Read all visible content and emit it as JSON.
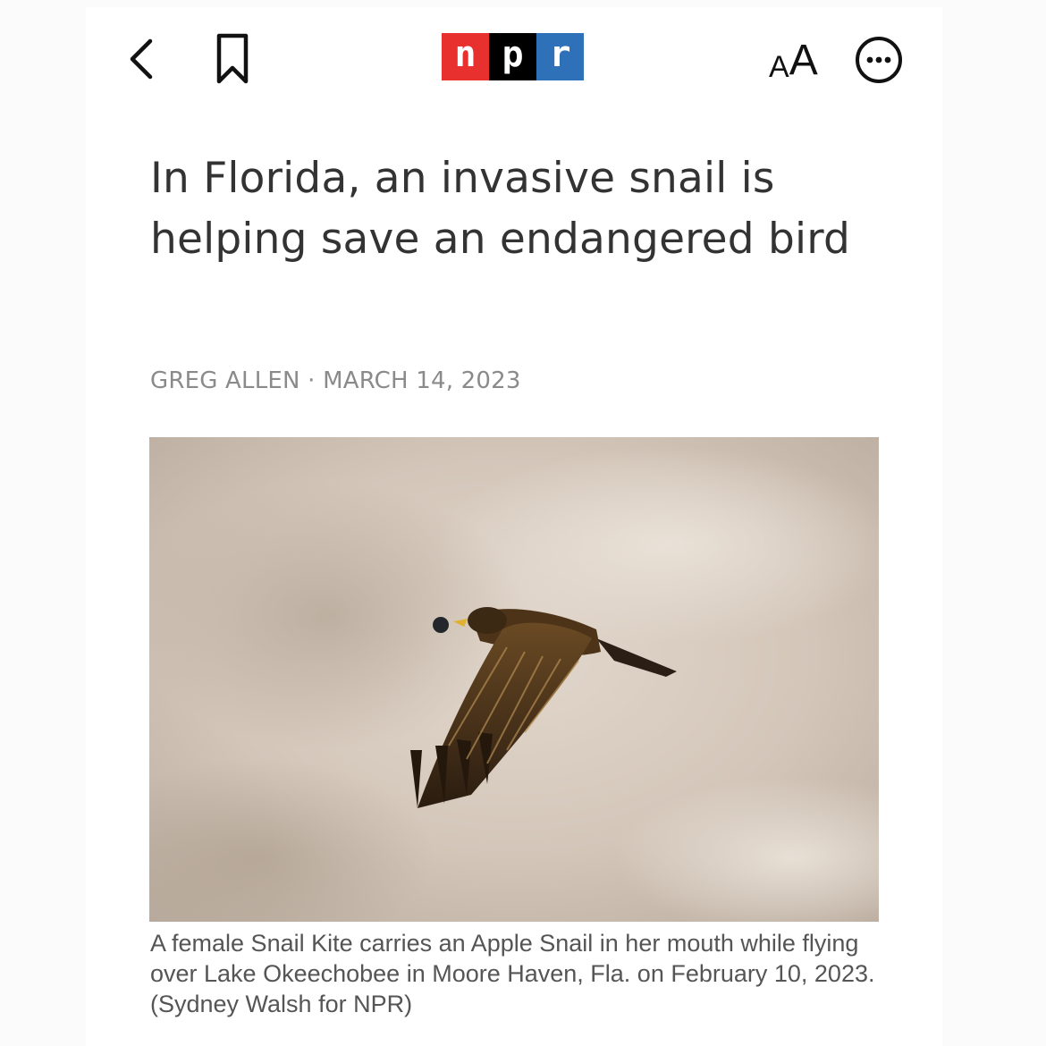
{
  "toolbar": {
    "back_icon": "chevron-left-icon",
    "bookmark_icon": "bookmark-icon",
    "logo": {
      "letters": [
        "n",
        "p",
        "r"
      ],
      "colors": [
        "#e8312f",
        "#000000",
        "#2e71b8"
      ]
    },
    "text_size_small": "A",
    "text_size_large": "A",
    "more_icon": "more-icon"
  },
  "article": {
    "headline": "In Florida, an invasive snail is helping save an endangered bird",
    "author": "GREG ALLEN",
    "separator": "·",
    "date": "MARCH 14, 2023",
    "image_caption": "A female Snail Kite carries an Apple Snail in her mouth while flying over Lake Okeechobee in Moore Haven, Fla. on February 10, 2023. (Sydney Walsh for NPR)"
  }
}
